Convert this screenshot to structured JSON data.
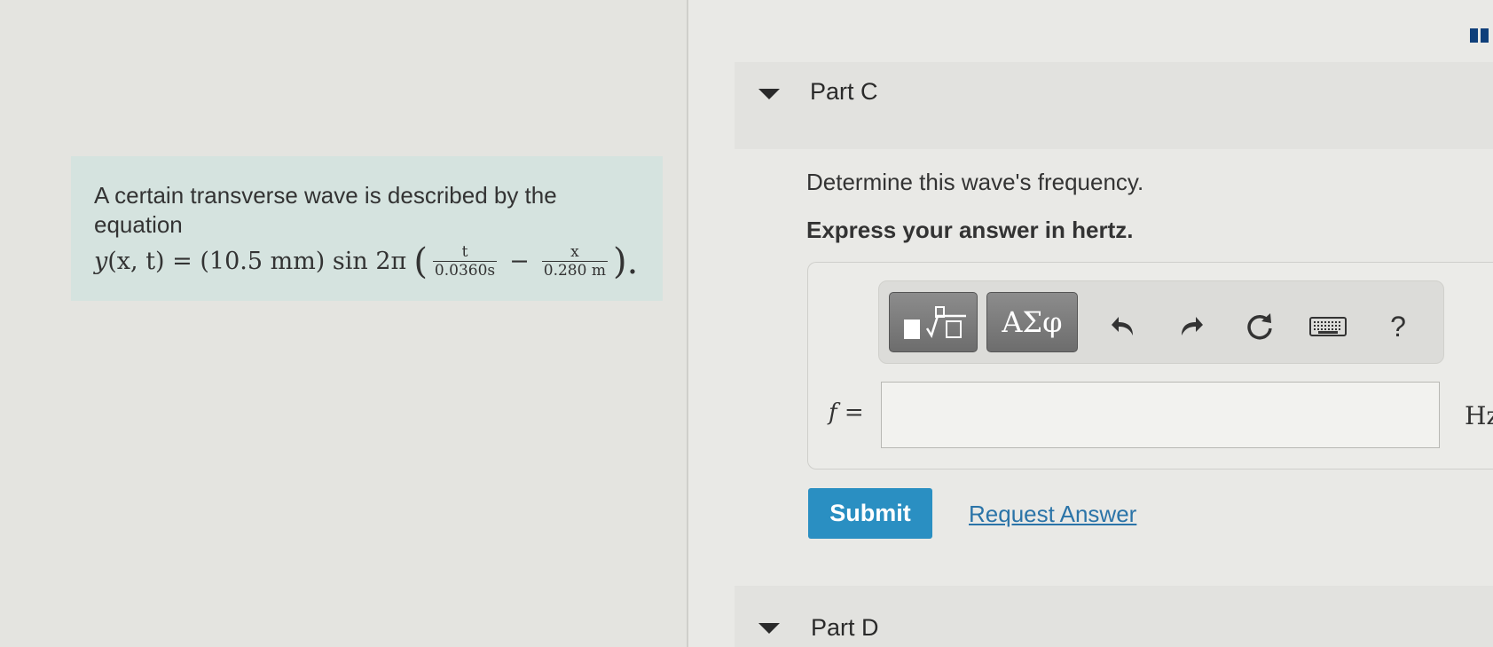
{
  "problem": {
    "text": "A certain transverse wave is described by the equation",
    "equation": {
      "lhs": "y(x, t) = (10.5 mm) sin 2π",
      "term1_num": "t",
      "term1_den": "0.0360s",
      "minus": "−",
      "term2_num": "x",
      "term2_den": "0.280 m",
      "open_paren": "(",
      "close_paren": ").",
      "lhs_y": "y",
      "lhs_rest": "(x, t) = (10.5 mm) sin 2π"
    }
  },
  "partC": {
    "title": "Part C",
    "question": "Determine this wave's frequency.",
    "instructions": "Express your answer in hertz.",
    "toolbar": {
      "templates_label": "√□",
      "greek_label": "ΑΣφ",
      "undo_icon": "undo-icon",
      "redo_icon": "redo-icon",
      "reset_icon": "reset-icon",
      "keyboard_icon": "keyboard-icon",
      "help_label": "?"
    },
    "variable_label": "f =",
    "answer_value": "",
    "unit": "Hz",
    "submit_label": "Submit",
    "request_label": "Request Answer"
  },
  "partD": {
    "title": "Part D"
  },
  "colors": {
    "problem_bg": "#d5e3df",
    "submit_bg": "#2a8fc2",
    "link": "#2b74a8"
  }
}
